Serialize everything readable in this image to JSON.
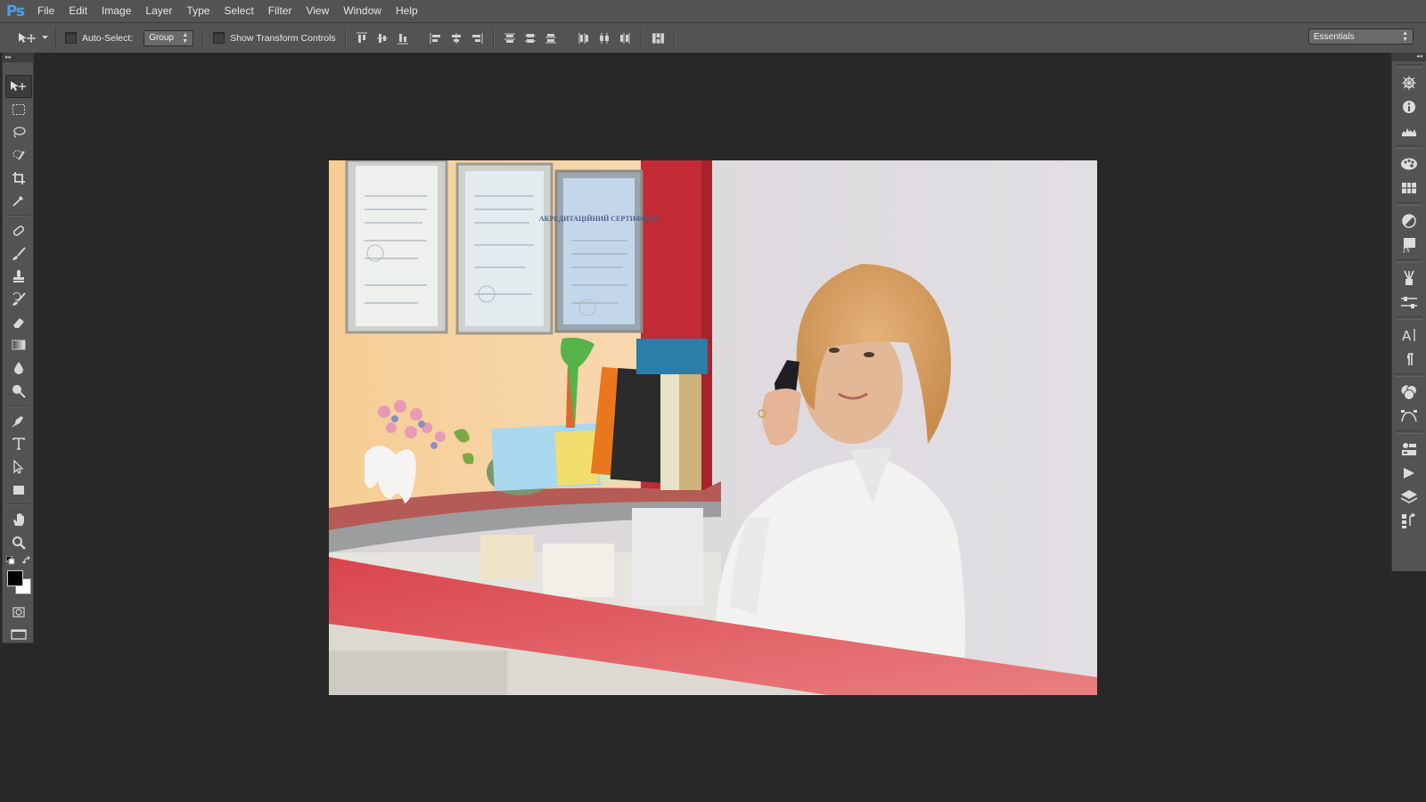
{
  "app": {
    "logo": "Ps"
  },
  "menu": [
    "File",
    "Edit",
    "Image",
    "Layer",
    "Type",
    "Select",
    "Filter",
    "View",
    "Window",
    "Help"
  ],
  "options": {
    "auto_select_label": "Auto-Select:",
    "auto_select_checked": false,
    "auto_select_target": "Group",
    "show_transform_label": "Show Transform Controls",
    "show_transform_checked": false,
    "workspace": "Essentials"
  },
  "tools": [
    "move",
    "rectangular-marquee",
    "lasso",
    "quick-selection",
    "crop",
    "eyedropper",
    "spot-healing-brush",
    "brush",
    "clone-stamp",
    "history-brush",
    "eraser",
    "gradient",
    "blur",
    "dodge",
    "pen",
    "type",
    "path-selection",
    "rectangle",
    "hand",
    "zoom"
  ],
  "active_tool": "move",
  "colors": {
    "foreground": "#000000",
    "background": "#ffffff"
  },
  "dock_panels": [
    "navigator",
    "info",
    "histogram",
    "color",
    "swatches",
    "adjustments",
    "styles",
    "brush-presets",
    "brush",
    "character",
    "paragraph",
    "masks",
    "paths",
    "channels",
    "actions",
    "layers",
    "history"
  ],
  "document": {
    "image_description": "portrait",
    "frame_texts": [
      "АКРЕДИТАЦІЙНИЙ СЕРТИФІКАТ"
    ]
  }
}
